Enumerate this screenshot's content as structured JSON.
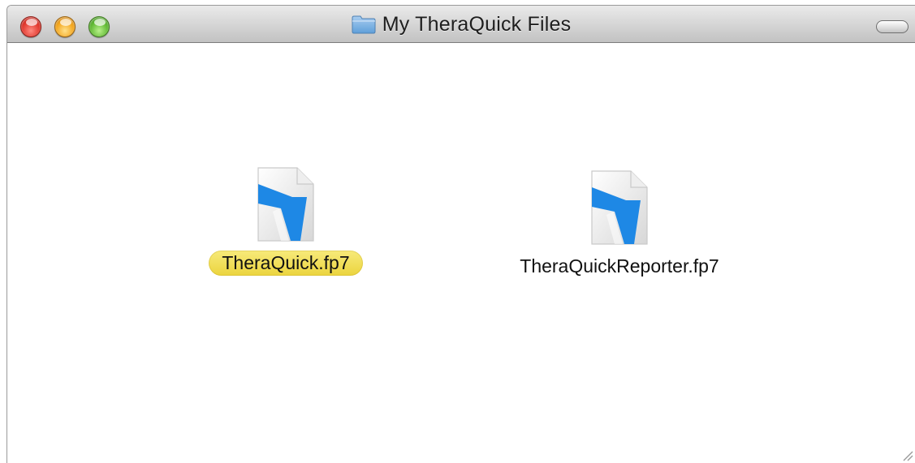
{
  "window": {
    "title": "My TheraQuick Files",
    "title_icon": "folder-icon"
  },
  "files": [
    {
      "name": "TheraQuick.fp7",
      "icon": "filemaker-document-icon",
      "selected": true
    },
    {
      "name": "TheraQuickReporter.fp7",
      "icon": "filemaker-document-icon",
      "selected": false
    }
  ],
  "colors": {
    "selection_highlight": "#eed948",
    "document_accent": "#1e88e5"
  }
}
